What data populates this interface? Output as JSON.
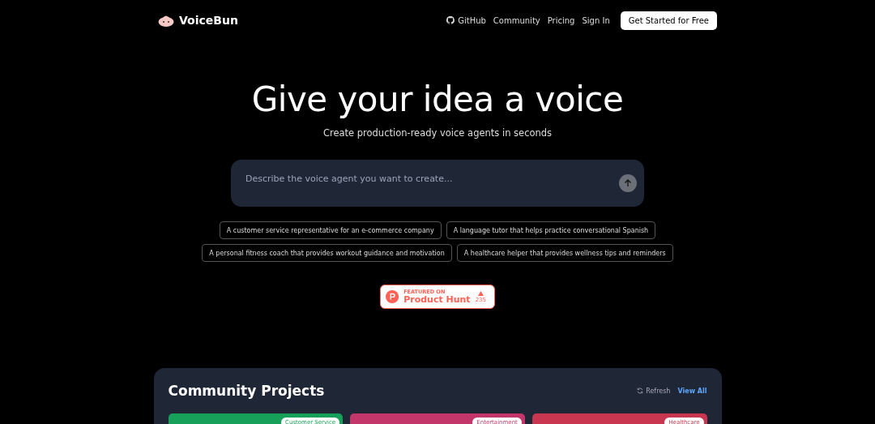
{
  "nav": {
    "brand": "VoiceBun",
    "links": [
      {
        "label": "GitHub",
        "kind": "github"
      },
      {
        "label": "Community",
        "kind": "plain"
      },
      {
        "label": "Pricing",
        "kind": "plain"
      },
      {
        "label": "Sign In",
        "kind": "plain"
      }
    ],
    "cta": "Get Started for Free"
  },
  "hero": {
    "title": "Give your idea a voice",
    "subtitle": "Create production-ready voice agents in seconds"
  },
  "prompt": {
    "placeholder": "Describe the voice agent you want to create..."
  },
  "suggestions": [
    [
      "A customer service representative for an e-commerce company",
      "A language tutor that helps practice conversational Spanish"
    ],
    [
      "A personal fitness coach that provides workout guidance and motivation",
      "A healthcare helper that provides wellness tips and reminders"
    ]
  ],
  "product_hunt": {
    "featured": "FEATURED ON",
    "name": "Product Hunt",
    "votes": "235"
  },
  "community": {
    "title": "Community Projects",
    "refresh": "Refresh",
    "view_all": "View All",
    "projects": [
      {
        "tag": "Customer Service",
        "color": "#16a05a"
      },
      {
        "tag": "Entertainment",
        "color": "#c2366a"
      },
      {
        "tag": "Healthcare",
        "color": "#c93650"
      }
    ]
  }
}
